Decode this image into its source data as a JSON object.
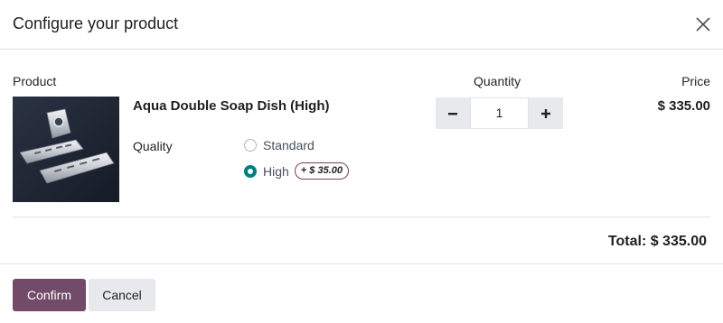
{
  "dialog": {
    "title": "Configure your product"
  },
  "table": {
    "headers": {
      "product": "Product",
      "quantity": "Quantity",
      "price": "Price"
    }
  },
  "product": {
    "name": "Aqua Double Soap Dish (High)",
    "attribute_label": "Quality",
    "options": [
      {
        "label": "Standard",
        "selected": false
      },
      {
        "label": "High",
        "selected": true,
        "extra": "+ $ 35.00"
      }
    ],
    "quantity": "1",
    "price": "$ 335.00"
  },
  "summary": {
    "total": "Total: $ 335.00"
  },
  "footer": {
    "confirm_label": "Confirm",
    "cancel_label": "Cancel"
  },
  "colors": {
    "primary": "#714b67",
    "radio_checked": "#017e84"
  }
}
